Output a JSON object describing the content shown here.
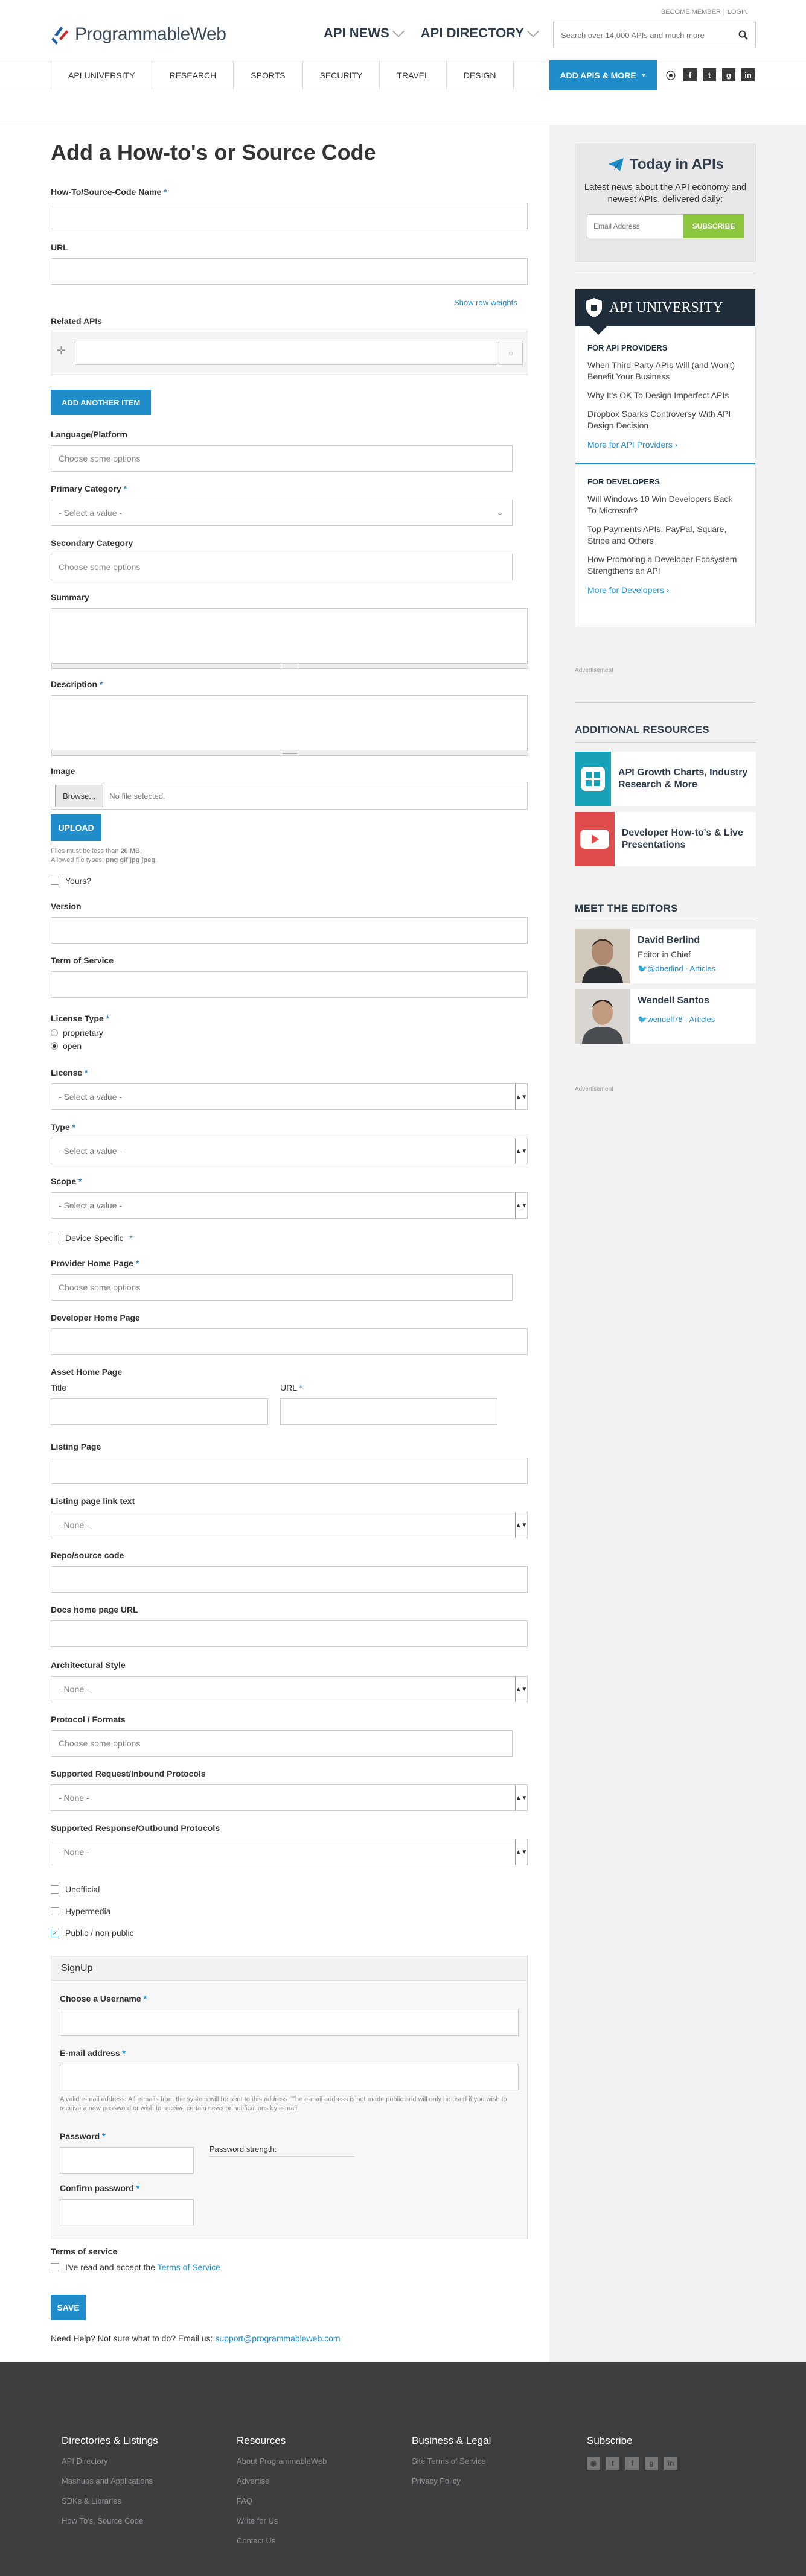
{
  "header": {
    "become_member": "BECOME MEMBER",
    "login": "LOGIN",
    "logo_text": "ProgrammableWeb",
    "nav": [
      "API NEWS",
      "API DIRECTORY"
    ],
    "search_placeholder": "Search over 14,000 APIs and much more"
  },
  "subnav": {
    "items": [
      "API UNIVERSITY",
      "RESEARCH",
      "SPORTS",
      "SECURITY",
      "TRAVEL",
      "DESIGN"
    ],
    "add_apis": "ADD APIS & MORE",
    "social_icons": [
      "rss-icon",
      "facebook-icon",
      "twitter-icon",
      "google-plus-icon",
      "linkedin-icon"
    ]
  },
  "form": {
    "title": "Add a How-to's or Source Code",
    "name_label": "How-To/Source-Code Name",
    "url_label": "URL",
    "show_row_weights": "Show row weights",
    "related_apis_label": "Related APIs",
    "add_another_item": "ADD ANOTHER ITEM",
    "language_label": "Language/Platform",
    "choose_options": "Choose some options",
    "primary_category_label": "Primary Category",
    "select_value": "- Select a value -",
    "secondary_category_label": "Secondary Category",
    "summary_label": "Summary",
    "description_label": "Description",
    "image_label": "Image",
    "browse": "Browse...",
    "no_file": "No file selected.",
    "upload": "UPLOAD",
    "files_size_note_prefix": "Files must be less than ",
    "files_size_value": "20 MB",
    "files_size_suffix": ".",
    "allowed_types_prefix": "Allowed file types: ",
    "allowed_types_value": "png gif jpg jpeg",
    "allowed_types_suffix": ".",
    "yours_label": "Yours?",
    "version_label": "Version",
    "tos_label": "Term of Service",
    "license_type_label": "License Type",
    "license_type_options": [
      "proprietary",
      "open"
    ],
    "license_label": "License",
    "type_label": "Type",
    "scope_label": "Scope",
    "device_specific_label": "Device-Specific",
    "provider_home_label": "Provider Home Page",
    "developer_home_label": "Developer Home Page",
    "asset_home_label": "Asset Home Page",
    "title_label": "Title",
    "url_sub_label": "URL",
    "listing_page_label": "Listing Page",
    "listing_link_text_label": "Listing page link text",
    "none": "- None -",
    "repo_label": "Repo/source code",
    "docs_label": "Docs home page URL",
    "arch_style_label": "Architectural Style",
    "protocol_formats_label": "Protocol / Formats",
    "req_protocols_label": "Supported Request/Inbound Protocols",
    "resp_protocols_label": "Supported Response/Outbound Protocols",
    "unofficial_label": "Unofficial",
    "hypermedia_label": "Hypermedia",
    "public_label": "Public / non public",
    "signup": {
      "title": "SignUp",
      "username_label": "Choose a Username",
      "email_label": "E-mail address",
      "email_help": "A valid e-mail address. All e-mails from the system will be sent to this address. The e-mail address is not made public and will only be used if you wish to receive a new password or wish to receive certain news or notifications by e-mail.",
      "password_label": "Password",
      "strength_label": "Password strength:",
      "confirm_label": "Confirm password",
      "terms_label": "Terms of service",
      "terms_text": "I've read and accept the ",
      "terms_link": "Terms of Service"
    },
    "save": "SAVE",
    "help_text": "Need Help? Not sure what to do? Email us: ",
    "help_email": "support@programmableweb.com"
  },
  "sidebar": {
    "today_title": "Today in APIs",
    "today_desc": "Latest news about the API economy and newest APIs, delivered daily:",
    "email_placeholder": "Email Address",
    "subscribe": "SUBSCRIBE",
    "api_university": "API UNIVERSITY",
    "for_providers": "FOR API PROVIDERS",
    "provider_items": [
      "When Third-Party APIs Will (and Won't) Benefit Your Business",
      "Why It's OK To Design Imperfect APIs",
      "Dropbox Sparks Controversy With API Design Decision"
    ],
    "more_providers": "More for API Providers ›",
    "for_developers": "FOR DEVELOPERS",
    "developer_items": [
      "Will Windows 10 Win Developers Back To Microsoft?",
      "Top Payments APIs: PayPal, Square, Stripe and Others",
      "How Promoting a Developer Ecosystem Strengthens an API"
    ],
    "more_developers": "More for Developers ›",
    "advertisement": "Advertisement",
    "additional_resources": "ADDITIONAL RESOURCES",
    "resources": [
      "API Growth Charts, Industry Research & More",
      "Developer How-to's & Live Presentations"
    ],
    "meet_editors": "MEET THE EDITORS",
    "editors": [
      {
        "name": "David Berlind",
        "role": "Editor in Chief",
        "twitter": "@dberlind",
        "articles": "Articles"
      },
      {
        "name": "Wendell Santos",
        "role": "",
        "twitter": "wendell78",
        "articles": "Articles"
      }
    ]
  },
  "footer": {
    "cols": [
      {
        "title": "Directories & Listings",
        "links": [
          "API Directory",
          "Mashups and Applications",
          "SDKs & Libraries",
          "How To's, Source Code"
        ]
      },
      {
        "title": "Resources",
        "links": [
          "About ProgrammableWeb",
          "Advertise",
          "FAQ",
          "Write for Us",
          "Contact Us"
        ]
      },
      {
        "title": "Business & Legal",
        "links": [
          "Site Terms of Service",
          "Privacy Policy"
        ]
      },
      {
        "title": "Subscribe",
        "links": []
      }
    ]
  },
  "colors": {
    "accent": "#1e8dc9",
    "subscribe_green": "#8cc63f",
    "footer_bg": "#3c3e40",
    "dark_navy": "#1f2d3a"
  }
}
